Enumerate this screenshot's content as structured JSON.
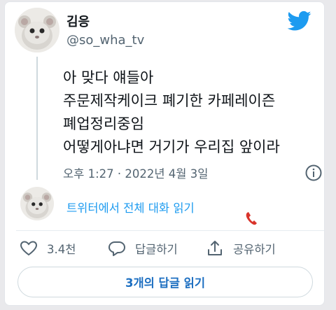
{
  "user": {
    "display_name": "김응",
    "handle": "@so_wha_tv"
  },
  "tweet": {
    "lines": "아 맞다 얘들아\n주문제작케이크 폐기한 카페레이즌\n폐업정리중임\n어떻게아냐면 거기가 우리집 앞이라",
    "timestamp": "오후 1:27 · 2022년 4월 3일"
  },
  "thread": {
    "read_conversation": "트위터에서 전체 대화 읽기"
  },
  "actions": {
    "like_count": "3.4천",
    "reply_label": "답글하기",
    "share_label": "공유하기"
  },
  "replies_button": "3개의 답글 읽기",
  "colors": {
    "accent": "#1d9bf0",
    "secondary_text": "#536471"
  },
  "icons": [
    "twitter-bird-icon",
    "info-icon",
    "heart-icon",
    "reply-bubble-icon",
    "share-icon",
    "phone-icon"
  ]
}
